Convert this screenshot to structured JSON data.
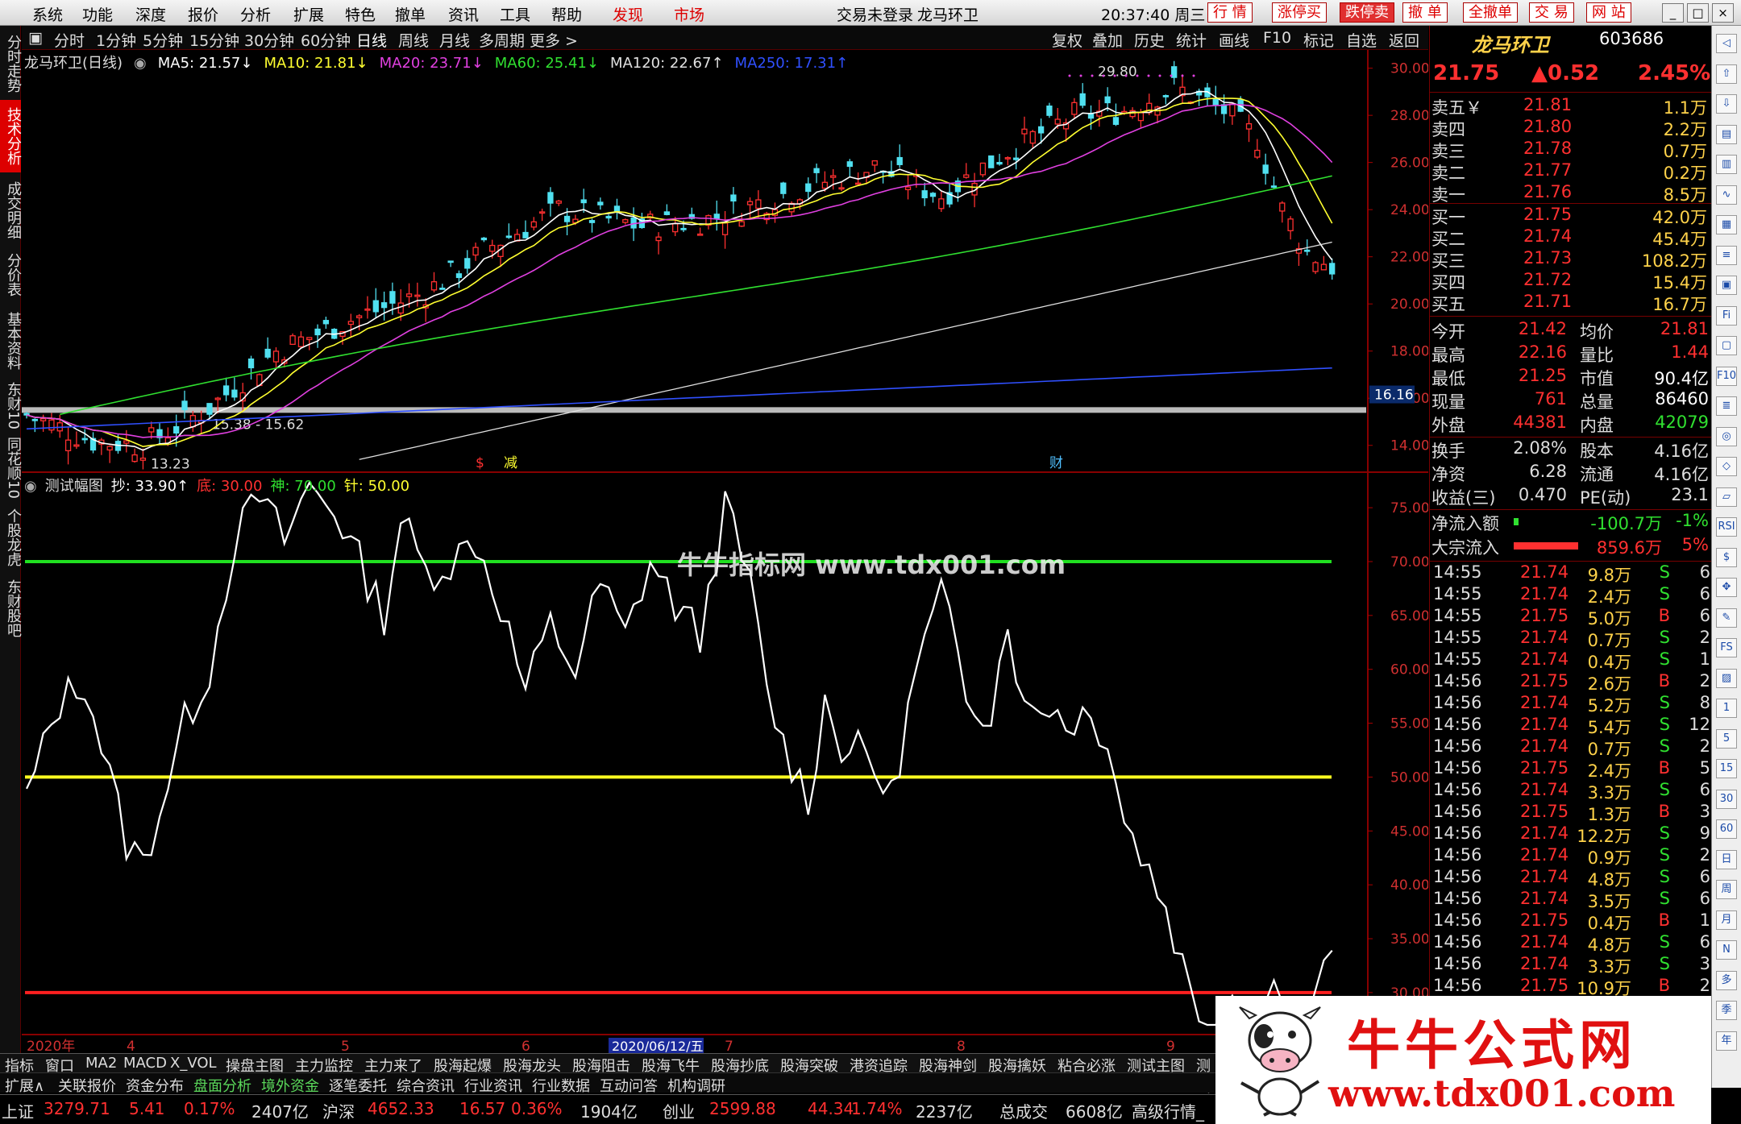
{
  "menubar": {
    "items": [
      "系统",
      "功能",
      "深度",
      "报价",
      "分析",
      "扩展",
      "特色",
      "撤单",
      "资讯",
      "工具",
      "帮助"
    ],
    "discover": "发现",
    "market": "市场",
    "status": "交易未登录",
    "stock_title": "龙马环卫",
    "clock": "20:37:40 周三",
    "right_buttons": [
      "行 情",
      "涨停买",
      "跌停卖",
      "撤 单",
      "全撤单",
      "交 易",
      "网 站"
    ]
  },
  "left_tabs": [
    "分时走势",
    "技术分析",
    "成交明细",
    "分价表",
    "基本资料",
    "东财10",
    "同花顺10",
    "个股龙虎",
    "东财股吧"
  ],
  "toolbar": {
    "periods": [
      "分时",
      "1分钟",
      "5分钟",
      "15分钟",
      "30分钟",
      "60分钟",
      "日线",
      "周线",
      "月线",
      "多周期",
      "更多 >"
    ],
    "right": [
      "复权",
      "叠加",
      "历史",
      "统计",
      "画线",
      "F10",
      "标记",
      "自选",
      "返回"
    ]
  },
  "ma_legend": {
    "name": "龙马环卫(日线)",
    "items": [
      {
        "text": "MA5: 21.57↓",
        "color": "#ffffff"
      },
      {
        "text": "MA10: 21.81↓",
        "color": "#ffff30"
      },
      {
        "text": "MA20: 23.71↓",
        "color": "#e040e0"
      },
      {
        "text": "MA60: 25.41↓",
        "color": "#30e030"
      },
      {
        "text": "MA120: 22.67↑",
        "color": "#e0e0e0"
      },
      {
        "text": "MA250: 17.31↑",
        "color": "#3050ff"
      }
    ]
  },
  "price_axis": [
    "30.00",
    "28.00",
    "26.00",
    "24.00",
    "22.00",
    "20.00",
    "18.00",
    "16.00",
    "14.00"
  ],
  "price_marker": "16.16",
  "annotations": {
    "high": "29.80",
    "low": "13.23",
    "band": "15.38 - 15.62",
    "sig1": "$",
    "sig2": "减",
    "sig3": "财"
  },
  "indicator_legend": {
    "name": "测试幅图",
    "items": [
      {
        "text": "抄: 33.90↑",
        "color": "#ffffff"
      },
      {
        "text": "底: 30.00",
        "color": "#ff3030"
      },
      {
        "text": "神: 70.00",
        "color": "#30e030"
      },
      {
        "text": "针: 50.00",
        "color": "#ffff30"
      }
    ]
  },
  "ind_axis": [
    "75.00",
    "70.00",
    "65.00",
    "60.00",
    "55.00",
    "50.00",
    "45.00",
    "40.00",
    "35.00",
    "30.00"
  ],
  "time_axis": {
    "labels": [
      "2020年",
      "4",
      "5",
      "6",
      "7",
      "8",
      "9"
    ],
    "cursor": "2020/06/12/五"
  },
  "chart_data": {
    "type": "candlestick+line",
    "stock": "龙马环卫",
    "period": "日线",
    "ylim": [
      13,
      30.5
    ],
    "ma_values": {
      "MA5": 21.57,
      "MA10": 21.81,
      "MA20": 23.71,
      "MA60": 25.41,
      "MA120": 22.67,
      "MA250": 17.31
    },
    "high": 29.8,
    "low": 13.23,
    "indicator": {
      "name": "测试幅图",
      "ylim": [
        27,
        78
      ],
      "lines": {
        "底": 30,
        "神": 70,
        "针": 50
      },
      "current": 33.9
    }
  },
  "quote": {
    "name": "龙马环卫",
    "code": "603686",
    "price": "21.75",
    "change": "▲0.52",
    "pct": "2.45%",
    "asks": [
      {
        "label": "卖五￥",
        "price": "21.81",
        "vol": "1.1万"
      },
      {
        "label": "卖四",
        "price": "21.80",
        "vol": "2.2万"
      },
      {
        "label": "卖三",
        "price": "21.78",
        "vol": "0.7万"
      },
      {
        "label": "卖二",
        "price": "21.77",
        "vol": "0.2万"
      },
      {
        "label": "卖一",
        "price": "21.76",
        "vol": "8.5万"
      }
    ],
    "bids": [
      {
        "label": "买一",
        "price": "21.75",
        "vol": "42.0万"
      },
      {
        "label": "买二",
        "price": "21.74",
        "vol": "45.4万"
      },
      {
        "label": "买三",
        "price": "21.73",
        "vol": "108.2万"
      },
      {
        "label": "买四",
        "price": "21.72",
        "vol": "15.4万"
      },
      {
        "label": "买五",
        "price": "21.71",
        "vol": "16.7万"
      }
    ],
    "stats": [
      {
        "l1": "今开",
        "v1": "21.42",
        "l2": "均价",
        "v2": "21.81",
        "c1": "#ff3030",
        "c2": "#ff3030"
      },
      {
        "l1": "最高",
        "v1": "22.16",
        "l2": "量比",
        "v2": "1.44",
        "c1": "#ff3030",
        "c2": "#ff3030"
      },
      {
        "l1": "最低",
        "v1": "21.25",
        "l2": "市值",
        "v2": "90.4亿",
        "c1": "#ff3030",
        "c2": "#ffffff"
      },
      {
        "l1": "现量",
        "v1": "761",
        "l2": "总量",
        "v2": "86460",
        "c1": "#ff3030",
        "c2": "#ffffff"
      },
      {
        "l1": "外盘",
        "v1": "44381",
        "l2": "内盘",
        "v2": "42079",
        "c1": "#ff3030",
        "c2": "#30e030"
      }
    ],
    "stats2": [
      {
        "l1": "换手",
        "v1": "2.08%",
        "l2": "股本",
        "v2": "4.16亿"
      },
      {
        "l1": "净资",
        "v1": "6.28",
        "l2": "流通",
        "v2": "4.16亿"
      },
      {
        "l1": "收益(三)",
        "v1": "0.470",
        "l2": "PE(动)",
        "v2": "23.1"
      }
    ],
    "flow": [
      {
        "label": "净流入额",
        "value": "-100.7万",
        "pct": "-1%",
        "vcolor": "#30e030",
        "pcolor": "#30e030",
        "bar": 0.03,
        "barcolor": "#30e030"
      },
      {
        "label": "大宗流入",
        "value": "859.6万",
        "pct": "5%",
        "vcolor": "#ff3030",
        "pcolor": "#ff3030",
        "bar": 1,
        "barcolor": "#ff3030"
      }
    ],
    "trades": [
      [
        "14:55",
        "21.74",
        "9.8万",
        "S",
        "6"
      ],
      [
        "14:55",
        "21.74",
        "2.4万",
        "S",
        "6"
      ],
      [
        "14:55",
        "21.75",
        "5.0万",
        "B",
        "6"
      ],
      [
        "14:55",
        "21.74",
        "0.7万",
        "S",
        "2"
      ],
      [
        "14:55",
        "21.74",
        "0.4万",
        "S",
        "1"
      ],
      [
        "14:56",
        "21.75",
        "2.6万",
        "B",
        "2"
      ],
      [
        "14:56",
        "21.74",
        "5.2万",
        "S",
        "8"
      ],
      [
        "14:56",
        "21.74",
        "5.4万",
        "S",
        "12"
      ],
      [
        "14:56",
        "21.74",
        "0.7万",
        "S",
        "2"
      ],
      [
        "14:56",
        "21.75",
        "2.4万",
        "B",
        "5"
      ],
      [
        "14:56",
        "21.74",
        "3.3万",
        "S",
        "6"
      ],
      [
        "14:56",
        "21.75",
        "1.3万",
        "B",
        "3"
      ],
      [
        "14:56",
        "21.74",
        "12.2万",
        "S",
        "9"
      ],
      [
        "14:56",
        "21.74",
        "0.9万",
        "S",
        "2"
      ],
      [
        "14:56",
        "21.74",
        "4.8万",
        "S",
        "6"
      ],
      [
        "14:56",
        "21.74",
        "3.5万",
        "S",
        "6"
      ],
      [
        "14:56",
        "21.75",
        "0.4万",
        "B",
        "1"
      ],
      [
        "14:56",
        "21.74",
        "4.8万",
        "S",
        "6"
      ],
      [
        "14:56",
        "21.74",
        "3.3万",
        "S",
        "3"
      ],
      [
        "14:56",
        "21.75",
        "10.9万",
        "B",
        "2"
      ]
    ]
  },
  "right_icons": [
    "◁",
    "⇧",
    "⇩",
    "▤",
    "▥",
    "∿",
    "▦",
    "≡",
    "▣",
    "Fi",
    "▢",
    "F10",
    "≣",
    "◎",
    "◇",
    "▱",
    "RSI",
    "$",
    "✥",
    "✎",
    "FS",
    "▨",
    "1",
    "5",
    "15",
    "30",
    "60",
    "日",
    "周",
    "月",
    "N",
    "多",
    "季",
    "年"
  ],
  "bottom_tabs": [
    "指标",
    "窗口",
    "MA2",
    "MACD",
    "X_VOL",
    "操盘主图",
    "主力监控",
    "主力来了",
    "股海起爆",
    "股海龙头",
    "股海阻击",
    "股海飞牛",
    "股海抄底",
    "股海突破",
    "港资追踪",
    "股海神剑",
    "股海擒妖",
    "粘合必涨",
    "测试主图",
    "测试"
  ],
  "tabs2": [
    "扩展∧",
    "关联报价",
    "资金分布",
    "盘面分析",
    "境外资金",
    "逐笔委托",
    "综合资讯",
    "行业资讯",
    "行业数据",
    "互动问答",
    "机构调研"
  ],
  "statusbar": [
    {
      "t": "上证",
      "c": "#dddddd"
    },
    {
      "t": "3279.71",
      "c": "#ff3030"
    },
    {
      "t": "5.41",
      "c": "#ff3030"
    },
    {
      "t": "0.17%",
      "c": "#ff3030"
    },
    {
      "t": "2407亿",
      "c": "#dddddd"
    },
    {
      "t": "沪深",
      "c": "#dddddd"
    },
    {
      "t": "4652.33",
      "c": "#ff3030"
    },
    {
      "t": "16.57",
      "c": "#ff3030"
    },
    {
      "t": "0.36%",
      "c": "#ff3030"
    },
    {
      "t": "1904亿",
      "c": "#dddddd"
    },
    {
      "t": "创业",
      "c": "#dddddd"
    },
    {
      "t": "2599.88",
      "c": "#ff3030"
    },
    {
      "t": "44.34",
      "c": "#ff3030"
    },
    {
      "t": "1.74%",
      "c": "#ff3030"
    },
    {
      "t": "2237亿",
      "c": "#dddddd"
    },
    {
      "t": "总成交",
      "c": "#dddddd"
    },
    {
      "t": "6608亿",
      "c": "#dddddd"
    },
    {
      "t": "高级行情_深",
      "c": "#dddddd"
    }
  ],
  "watermark": "牛牛指标网 www.tdx001.com",
  "brand": {
    "title": "牛牛公式网",
    "url": "www.tdx001.com"
  }
}
